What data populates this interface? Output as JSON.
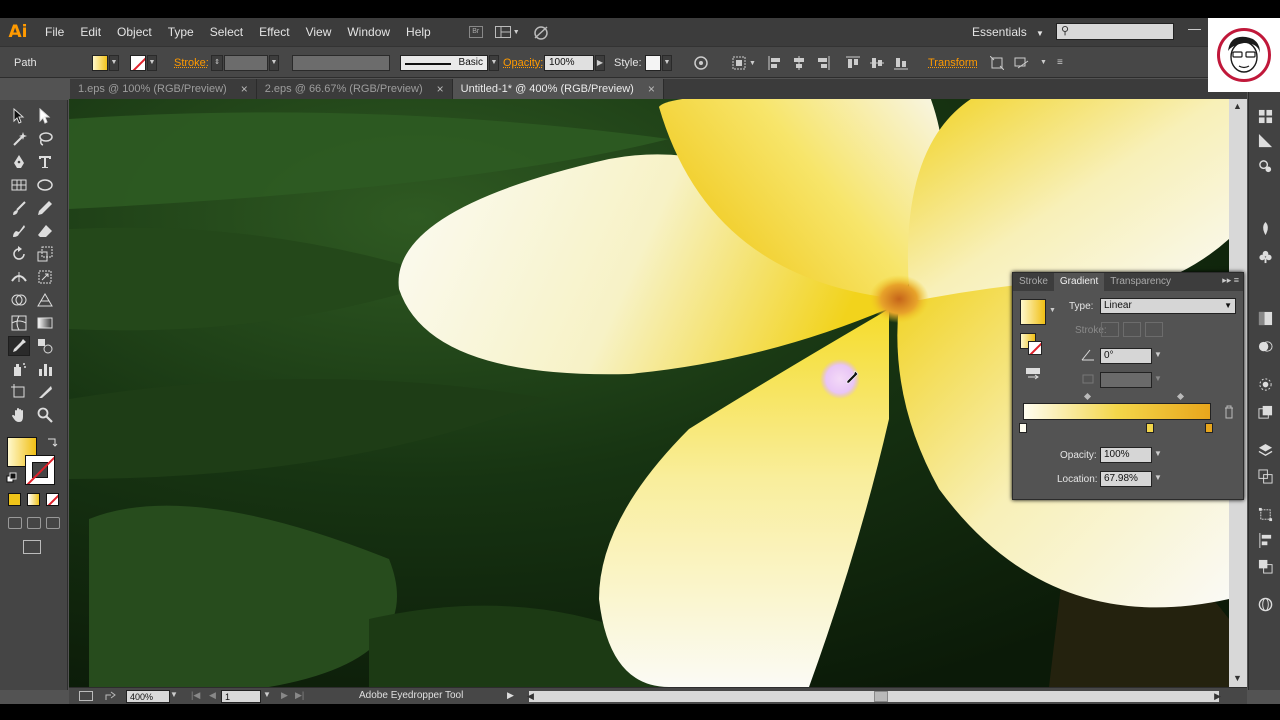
{
  "app": {
    "logo": "Ai",
    "menu": [
      "File",
      "Edit",
      "Object",
      "Type",
      "Select",
      "Effect",
      "View",
      "Window",
      "Help"
    ],
    "workspace": "Essentials",
    "search_placeholder": ""
  },
  "control_bar": {
    "selection_type": "Path",
    "stroke_label": "Stroke:",
    "brush_name": "Basic",
    "opacity_label": "Opacity:",
    "opacity_value": "100%",
    "style_label": "Style:",
    "transform_label": "Transform"
  },
  "tabs": [
    {
      "label": "1.eps @ 100% (RGB/Preview)",
      "active": false
    },
    {
      "label": "2.eps @ 66.67% (RGB/Preview)",
      "active": false
    },
    {
      "label": "Untitled-1* @ 400% (RGB/Preview)",
      "active": true
    }
  ],
  "tab_close": "×",
  "gradient_panel": {
    "tabs": [
      "Stroke",
      "Gradient",
      "Transparency"
    ],
    "type_label": "Type:",
    "type_value": "Linear",
    "stroke_label": "Stroke:",
    "angle_value": "0°",
    "opacity_label": "Opacity:",
    "opacity_value": "100%",
    "location_label": "Location:",
    "location_value": "67.98%",
    "gradient_stops": [
      "#fffdf0",
      "#f3d64a",
      "#e8a61c"
    ]
  },
  "status_bar": {
    "zoom": "400%",
    "artboard": "1",
    "tool_name": "Adobe Eyedropper Tool"
  },
  "colors": {
    "accent": "#ff9a00",
    "fill_start": "#fff8cc",
    "fill_end": "#f0bf14",
    "stroke_none": "#e0202a"
  }
}
